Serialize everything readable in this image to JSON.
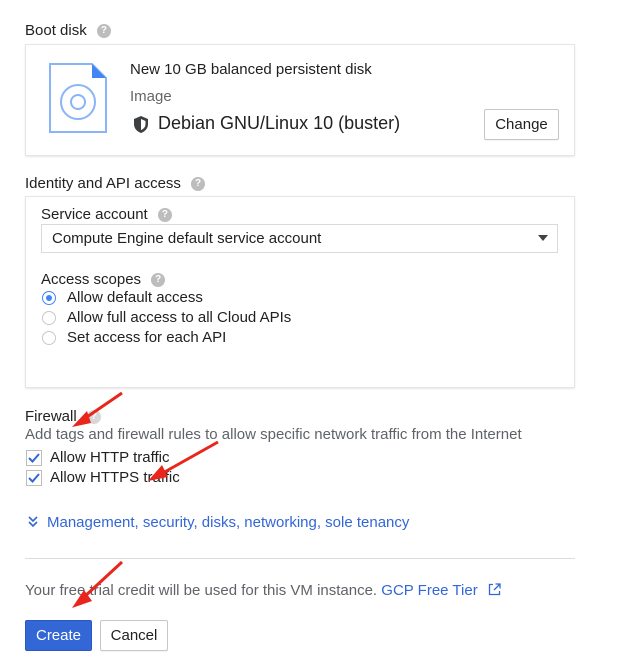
{
  "boot_disk": {
    "label": "Boot disk",
    "title": "New 10 GB balanced persistent disk",
    "subtitle": "Image",
    "image_name": "Debian GNU/Linux 10 (buster)",
    "change_button": "Change"
  },
  "identity": {
    "label": "Identity and API access",
    "service_account_label": "Service account",
    "service_account_value": "Compute Engine default service account",
    "access_scopes_label": "Access scopes",
    "scopes": [
      {
        "label": "Allow default access",
        "checked": true
      },
      {
        "label": "Allow full access to all Cloud APIs",
        "checked": false
      },
      {
        "label": "Set access for each API",
        "checked": false
      }
    ]
  },
  "firewall": {
    "label": "Firewall",
    "description": "Add tags and firewall rules to allow specific network traffic from the Internet",
    "http_label": "Allow HTTP traffic",
    "https_label": "Allow HTTPS traffic"
  },
  "management_link": "Management, security, disks, networking, sole tenancy",
  "footer": {
    "credit_text": "Your free trial credit will be used for this VM instance.",
    "gcp_link": "GCP Free Tier",
    "create_button": "Create",
    "cancel_button": "Cancel"
  },
  "colors": {
    "accent": "#3367d6",
    "annotation_arrow": "#e8261c"
  }
}
